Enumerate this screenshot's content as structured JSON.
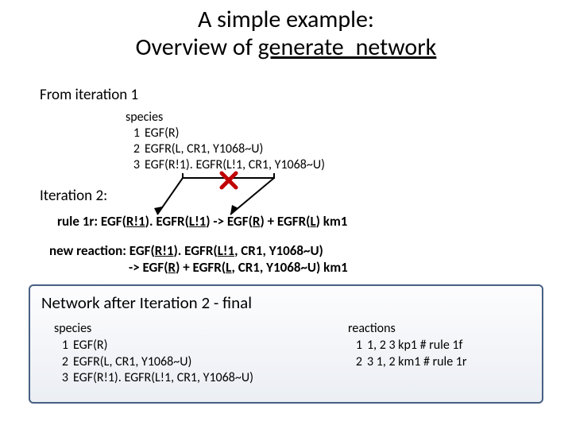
{
  "title_line1": "A simple example:",
  "title_line2_pre": "Overview of ",
  "title_line2_underlined": "generate_network",
  "from_iteration": "From iteration 1",
  "species_top": {
    "header": "species",
    "items": [
      {
        "n": "1",
        "t": "EGF(R)"
      },
      {
        "n": "2",
        "t": "EGFR(L, CR1, Y1068~U)"
      },
      {
        "n": "3",
        "t": "EGF(R!1). EGFR(L!1, CR1, Y1068~U)"
      }
    ]
  },
  "iter2_label": "Iteration 2:",
  "rule": {
    "prefix": "rule 1r: EGF(",
    "u1": "R!1",
    "mid1": "). EGFR(",
    "u2": "L!1",
    "mid2": ") -> EGF(",
    "u3": "R",
    "mid3": ") + EGFR(",
    "u4": "L",
    "suffix": ") km1"
  },
  "newreact": {
    "l1a": "new reaction: EGF(",
    "l1u1": "R!1",
    "l1b": "). EGFR(",
    "l1u2": "L!1",
    "l1c": ", CR1, Y1068~U)",
    "l2a": "-> EGF(",
    "l2u1": "R",
    "l2b": ") + EGFR(",
    "l2u2": "L",
    "l2c": ", CR1, Y1068~U) km1"
  },
  "final": {
    "title": "Network after Iteration 2 - final",
    "species_header": "species",
    "species": [
      {
        "n": "1",
        "t": "EGF(R)"
      },
      {
        "n": "2",
        "t": "EGFR(L, CR1, Y1068~U)"
      },
      {
        "n": "3",
        "t": "EGF(R!1). EGFR(L!1, CR1, Y1068~U)"
      }
    ],
    "reactions_header": "reactions",
    "reactions": [
      {
        "n": "1",
        "t": "1, 2 3 kp1 # rule 1f"
      },
      {
        "n": "2",
        "t": "3 1, 2 km1 # rule 1r"
      }
    ]
  }
}
